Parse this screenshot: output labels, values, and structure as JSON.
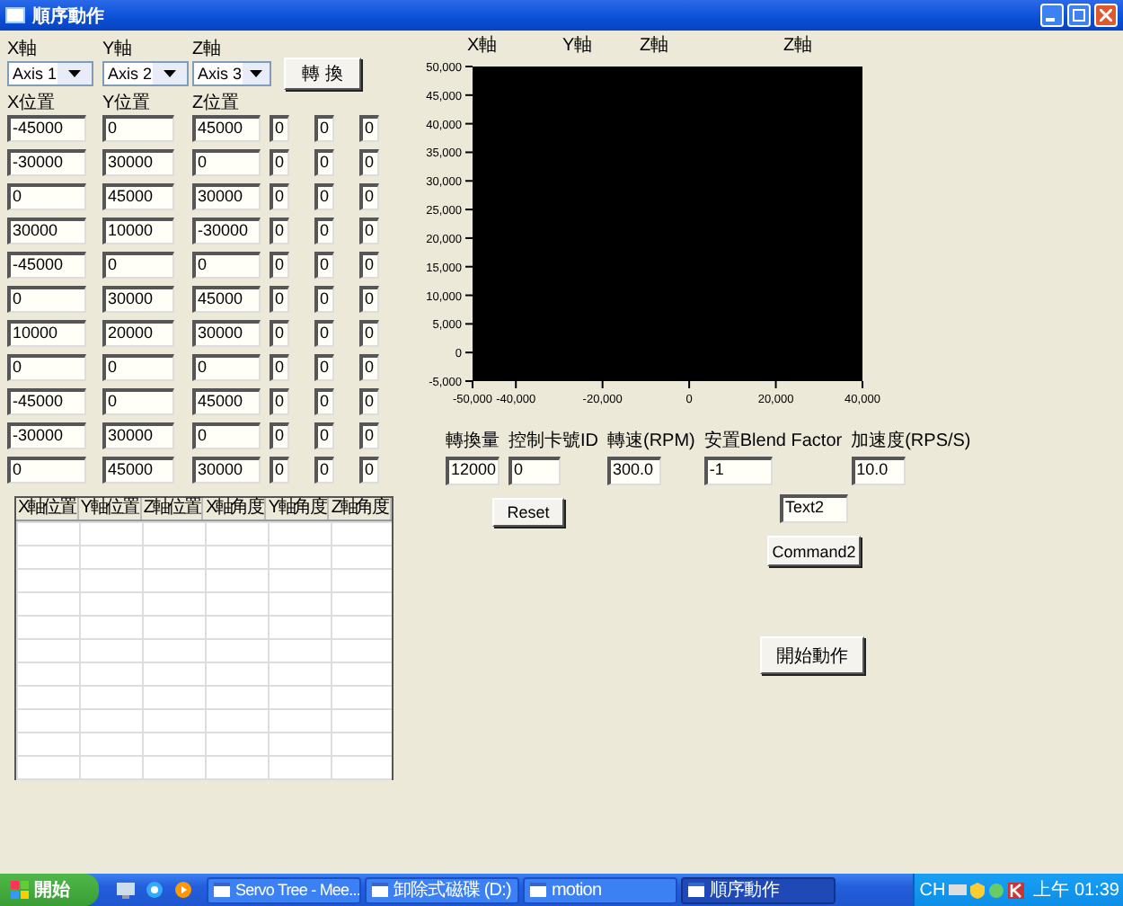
{
  "window": {
    "title": "順序動作"
  },
  "axis_selectors": [
    {
      "label": "X軸",
      "value": "Axis 1"
    },
    {
      "label": "Y軸",
      "value": "Axis 2"
    },
    {
      "label": "Z軸",
      "value": "Axis 3"
    }
  ],
  "convert_button": "轉 換",
  "position_headers": [
    "X位置",
    "Y位置",
    "Z位置"
  ],
  "position_rows": [
    [
      "-45000",
      "0",
      "45000",
      "0",
      "0",
      "0"
    ],
    [
      "-30000",
      "30000",
      "0",
      "0",
      "0",
      "0"
    ],
    [
      "0",
      "45000",
      "30000",
      "0",
      "0",
      "0"
    ],
    [
      "30000",
      "10000",
      "-30000",
      "0",
      "0",
      "0"
    ],
    [
      "-45000",
      "0",
      "0",
      "0",
      "0",
      "0"
    ],
    [
      "0",
      "30000",
      "45000",
      "0",
      "0",
      "0"
    ],
    [
      "10000",
      "20000",
      "30000",
      "0",
      "0",
      "0"
    ],
    [
      "0",
      "0",
      "0",
      "0",
      "0",
      "0"
    ],
    [
      "-45000",
      "0",
      "45000",
      "0",
      "0",
      "0"
    ],
    [
      "-30000",
      "30000",
      "0",
      "0",
      "0",
      "0"
    ],
    [
      "0",
      "45000",
      "30000",
      "0",
      "0",
      "0"
    ]
  ],
  "table": {
    "columns": [
      "X軸位置",
      "Y軸位置",
      "Z軸位置",
      "X軸角度",
      "Y軸角度",
      "Z軸角度"
    ]
  },
  "chart": {
    "axis_labels": [
      "X軸",
      "Y軸",
      "Z軸",
      "Z軸"
    ],
    "chart_data": {
      "type": "scatter",
      "xlim": [
        -50000,
        40000
      ],
      "ylim": [
        -5000,
        50000
      ],
      "xticks": [
        {
          "value": -50000,
          "label": "-50,000"
        },
        {
          "value": -40000,
          "label": "-40,000"
        },
        {
          "value": -20000,
          "label": "-20,000"
        },
        {
          "value": 0,
          "label": "0"
        },
        {
          "value": 20000,
          "label": "20,000"
        },
        {
          "value": 40000,
          "label": "40,000"
        }
      ],
      "yticks": [
        {
          "value": 50000,
          "label": "50,000"
        },
        {
          "value": 45000,
          "label": "45,000"
        },
        {
          "value": 40000,
          "label": "40,000"
        },
        {
          "value": 35000,
          "label": "35,000"
        },
        {
          "value": 30000,
          "label": "30,000"
        },
        {
          "value": 25000,
          "label": "25,000"
        },
        {
          "value": 20000,
          "label": "20,000"
        },
        {
          "value": 15000,
          "label": "15,000"
        },
        {
          "value": 10000,
          "label": "10,000"
        },
        {
          "value": 5000,
          "label": "5,000"
        },
        {
          "value": 0,
          "label": "0"
        },
        {
          "value": -5000,
          "label": "-5,000"
        }
      ]
    }
  },
  "parameters": [
    {
      "label": "轉換量",
      "value": "12000"
    },
    {
      "label": "控制卡號ID",
      "value": "0"
    },
    {
      "label": "轉速(RPM)",
      "value": "300.0"
    },
    {
      "label": "安置Blend Factor",
      "value": "-1"
    },
    {
      "label": "加速度(RPS/S)",
      "value": "10.0"
    }
  ],
  "reset_button": "Reset",
  "text_field": "Text2",
  "command_button": "Command2",
  "start_motion_button": "開始動作",
  "taskbar": {
    "start": "開始",
    "tasks": [
      {
        "label": "Servo Tree - Mee...",
        "selected": false
      },
      {
        "label": "卸除式磁碟 (D:)",
        "selected": false
      },
      {
        "label": "motion",
        "selected": false
      },
      {
        "label": "順序動作",
        "selected": true
      }
    ],
    "tray": {
      "language": "CH",
      "clock": "上午 01:39"
    }
  }
}
